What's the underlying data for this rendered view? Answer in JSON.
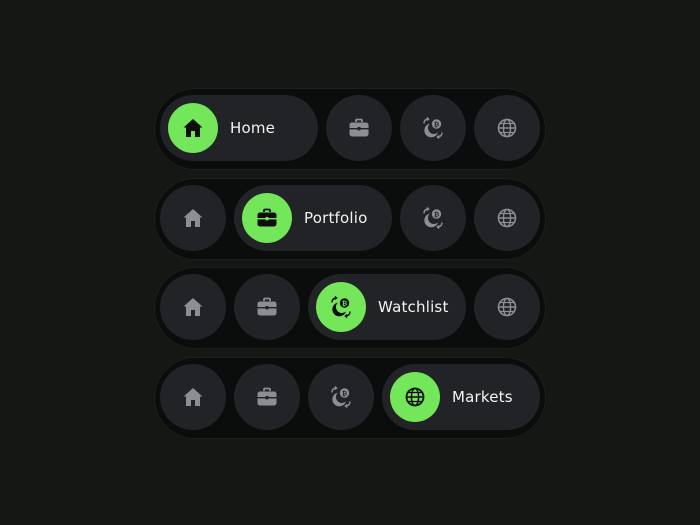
{
  "colors": {
    "background": "#141714",
    "bar": "#0b0c0c",
    "button": "#222327",
    "accent": "#73e65a",
    "icon_inactive": "#8c8e92",
    "icon_active": "#0d0f0d",
    "text": "#f2f3f2"
  },
  "navbars": [
    {
      "active": "home",
      "active_label": "Home",
      "items": [
        "home-icon",
        "briefcase-icon",
        "crypto-exchange-icon",
        "globe-icon"
      ]
    },
    {
      "active": "portfolio",
      "active_label": "Portfolio",
      "items": [
        "home-icon",
        "briefcase-icon",
        "crypto-exchange-icon",
        "globe-icon"
      ]
    },
    {
      "active": "watchlist",
      "active_label": "Watchlist",
      "items": [
        "home-icon",
        "briefcase-icon",
        "crypto-exchange-icon",
        "globe-icon"
      ]
    },
    {
      "active": "markets",
      "active_label": "Markets",
      "items": [
        "home-icon",
        "briefcase-icon",
        "crypto-exchange-icon",
        "globe-icon"
      ]
    }
  ]
}
